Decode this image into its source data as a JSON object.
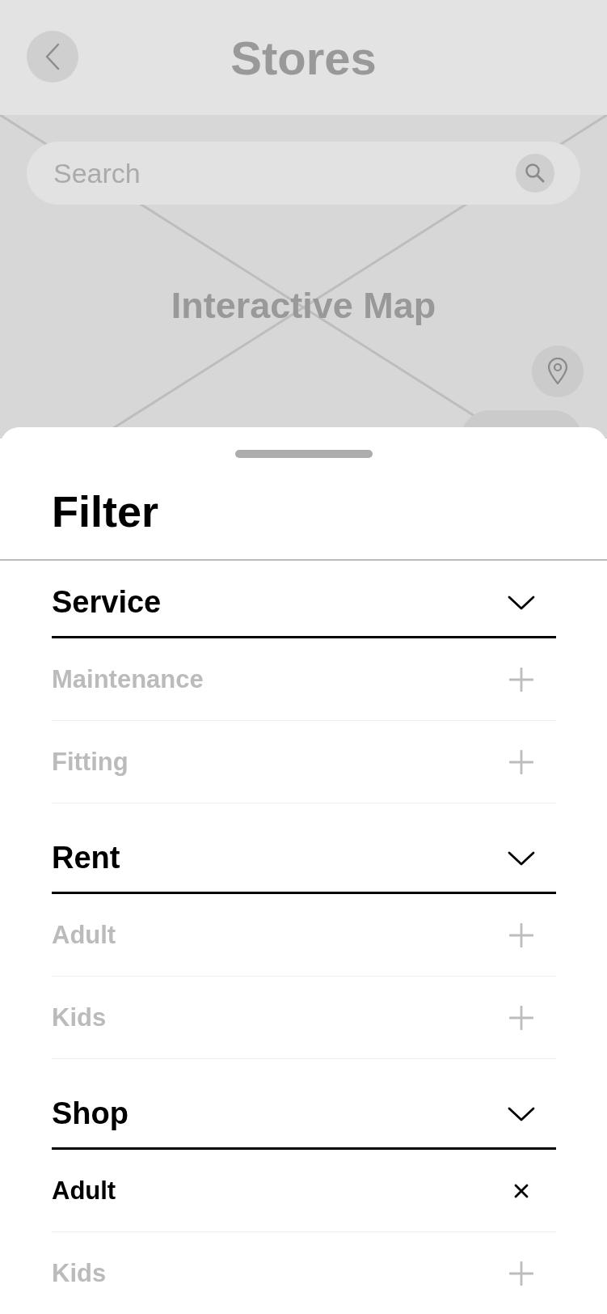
{
  "header": {
    "title": "Stores"
  },
  "search": {
    "placeholder": "Search"
  },
  "map": {
    "label": "Interactive Map"
  },
  "sheet": {
    "title": "Filter"
  },
  "sections": [
    {
      "title": "Service",
      "expanded": true,
      "options": [
        {
          "label": "Maintenance",
          "selected": false
        },
        {
          "label": "Fitting",
          "selected": false
        }
      ]
    },
    {
      "title": "Rent",
      "expanded": true,
      "options": [
        {
          "label": "Adult",
          "selected": false
        },
        {
          "label": "Kids",
          "selected": false
        }
      ]
    },
    {
      "title": "Shop",
      "expanded": true,
      "options": [
        {
          "label": "Adult",
          "selected": true
        },
        {
          "label": "Kids",
          "selected": false
        }
      ]
    }
  ]
}
